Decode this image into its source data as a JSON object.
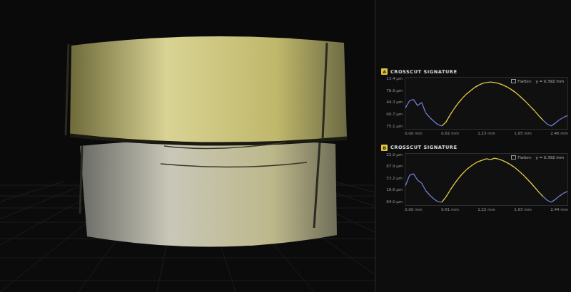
{
  "panels": [
    {
      "badge": "A",
      "title": "CROSSCUT SIGNATURE",
      "legend": {
        "toggle": "Flatten",
        "reading": "y = 0.392 mm"
      },
      "y_ticks": [
        "13.4 µm",
        "78.8 µm",
        "44.3 µm",
        "09.7 µm",
        "75.1 µm"
      ],
      "x_ticks": [
        "0.00 mm",
        "0.62 mm",
        "1.23 mm",
        "1.85 mm",
        "2.46 mm"
      ],
      "series": [
        40,
        55,
        58,
        45,
        52,
        30,
        20,
        12,
        5,
        2,
        10,
        25,
        38,
        50,
        60,
        69,
        76,
        83,
        88,
        92,
        94,
        95,
        94,
        92,
        89,
        85,
        80,
        74,
        67,
        59,
        51,
        42,
        33,
        23,
        14,
        6,
        2,
        8,
        15,
        20,
        24
      ]
    },
    {
      "badge": "B",
      "title": "CROSSCUT SIGNATURE",
      "legend": {
        "toggle": "Flatten",
        "reading": "y = 0.392 mm"
      },
      "y_ticks": [
        "22.0 µm",
        "87.9 µm",
        "53.2 µm",
        "18.6 µm",
        "84.0 µm"
      ],
      "x_ticks": [
        "0.00 mm",
        "0.61 mm",
        "1.22 mm",
        "1.83 mm",
        "2.44 mm"
      ],
      "series": [
        38,
        60,
        64,
        50,
        44,
        28,
        18,
        10,
        4,
        3,
        14,
        28,
        41,
        53,
        63,
        72,
        79,
        85,
        90,
        93,
        96,
        94,
        97,
        95,
        92,
        88,
        83,
        77,
        70,
        62,
        53,
        44,
        34,
        24,
        15,
        7,
        3,
        9,
        16,
        22,
        26
      ]
    }
  ]
}
